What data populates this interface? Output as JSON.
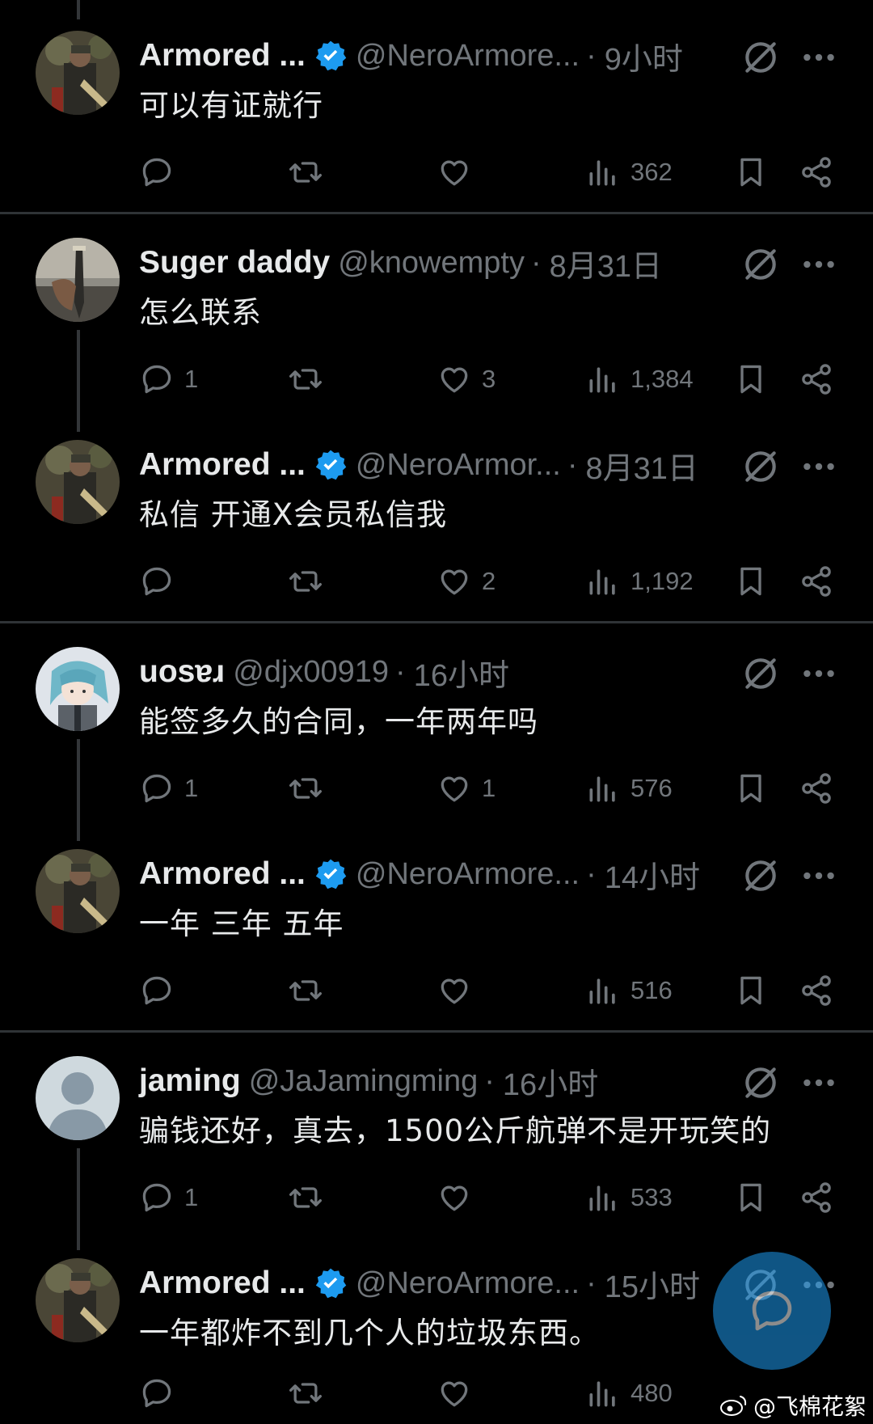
{
  "tweets": [
    {
      "name": "Armored ...",
      "verified": true,
      "handle": "@NeroArmore...",
      "time": "9小时",
      "text": "可以有证就行",
      "replies": "",
      "likes": "",
      "views": "362",
      "avatar": "soldier-avatar"
    },
    {
      "name": "Suger daddy",
      "verified": false,
      "handle": "@knowempty",
      "time": "8月31日",
      "text": "怎么联系",
      "replies": "1",
      "likes": "3",
      "views": "1,384",
      "avatar": "knife-avatar"
    },
    {
      "name": "Armored ...",
      "verified": true,
      "handle": "@NeroArmor...",
      "time": "8月31日",
      "text": "私信  开通X会员私信我",
      "replies": "",
      "likes": "2",
      "views": "1,192",
      "avatar": "soldier-avatar"
    },
    {
      "name": "uosɐɹ",
      "verified": false,
      "handle": "@djx00919",
      "time": "16小时",
      "text": "能签多久的合同，一年两年吗",
      "replies": "1",
      "likes": "1",
      "views": "576",
      "avatar": "anime-avatar"
    },
    {
      "name": "Armored ...",
      "verified": true,
      "handle": "@NeroArmore...",
      "time": "14小时",
      "text": "一年  三年  五年",
      "replies": "",
      "likes": "",
      "views": "516",
      "avatar": "soldier-avatar"
    },
    {
      "name": "jaming",
      "verified": false,
      "handle": "@JaJamingming",
      "time": "16小时",
      "text": "骗钱还好，真去，1500公斤航弹不是开玩笑的",
      "replies": "1",
      "likes": "",
      "views": "533",
      "avatar": "default-avatar"
    },
    {
      "name": "Armored ...",
      "verified": true,
      "handle": "@NeroArmore...",
      "time": "15小时",
      "text": "一年都炸不到几个人的垃圾东西。",
      "replies": "",
      "likes": "",
      "views": "480",
      "avatar": "soldier-avatar"
    }
  ],
  "watermark": "@飞棉花絮",
  "colors": {
    "background": "#000000",
    "text": "#e7e9ea",
    "muted": "#71767b",
    "verified": "#1d9bf0",
    "separator": "#2f3336"
  }
}
